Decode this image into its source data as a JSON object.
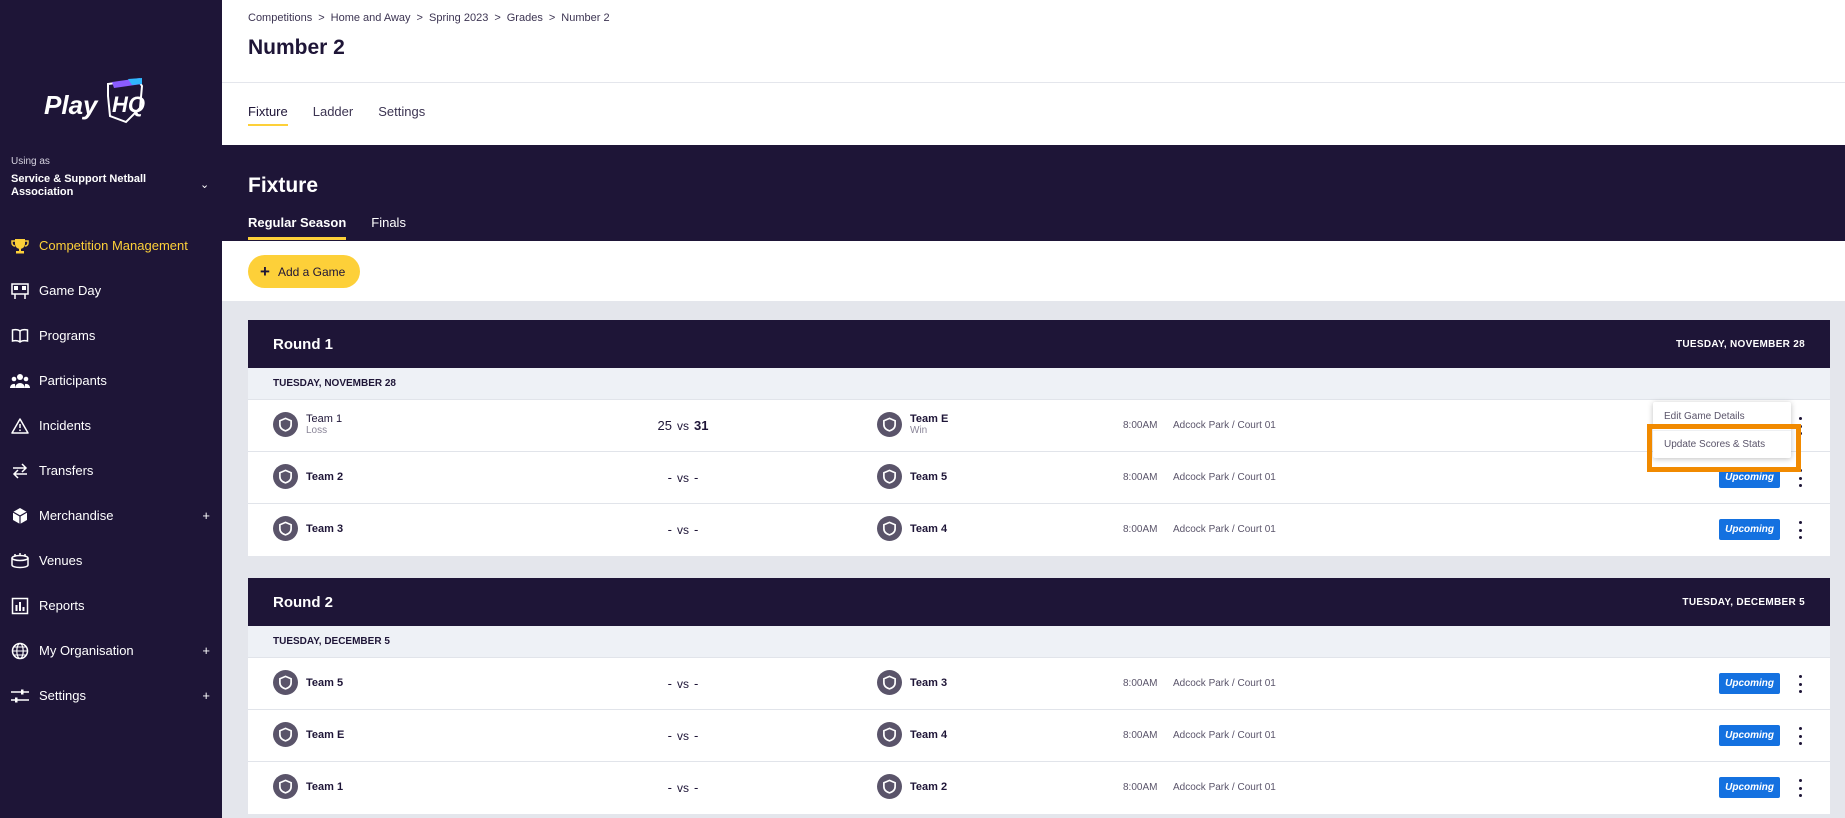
{
  "sidebar": {
    "logo_text": "PlayHQ",
    "using_as_label": "Using as",
    "org_name": "Service & Support Netball Association",
    "org_chevron": "⌄",
    "items": [
      {
        "label": "Competition Management",
        "icon": "trophy-icon",
        "active": true,
        "expandable": false
      },
      {
        "label": "Game Day",
        "icon": "scoreboard-icon",
        "active": false,
        "expandable": false
      },
      {
        "label": "Programs",
        "icon": "book-icon",
        "active": false,
        "expandable": false
      },
      {
        "label": "Participants",
        "icon": "people-icon",
        "active": false,
        "expandable": false
      },
      {
        "label": "Incidents",
        "icon": "warning-icon",
        "active": false,
        "expandable": false
      },
      {
        "label": "Transfers",
        "icon": "transfer-arrows-icon",
        "active": false,
        "expandable": false
      },
      {
        "label": "Merchandise",
        "icon": "box-icon",
        "active": false,
        "expandable": true
      },
      {
        "label": "Venues",
        "icon": "stadium-icon",
        "active": false,
        "expandable": false
      },
      {
        "label": "Reports",
        "icon": "report-icon",
        "active": false,
        "expandable": false
      },
      {
        "label": "My Organisation",
        "icon": "globe-icon",
        "active": false,
        "expandable": true
      },
      {
        "label": "Settings",
        "icon": "sliders-icon",
        "active": false,
        "expandable": true
      }
    ],
    "expand_symbol": "+"
  },
  "header": {
    "breadcrumb": [
      "Competitions",
      "Home and Away",
      "Spring 2023",
      "Grades",
      "Number 2"
    ],
    "breadcrumb_sep": ">",
    "title": "Number 2",
    "tabs": [
      "Fixture",
      "Ladder",
      "Settings"
    ]
  },
  "fixture": {
    "title": "Fixture",
    "subtabs": [
      "Regular Season",
      "Finals"
    ],
    "add_game_label": "Add a Game"
  },
  "rounds": [
    {
      "title": "Round 1",
      "date": "TUESDAY, NOVEMBER 28",
      "day_label": "TUESDAY, NOVEMBER 28",
      "games": [
        {
          "home": "Team 1",
          "home_result": "Loss",
          "home_score": "25",
          "away": "Team E",
          "away_result": "Win",
          "away_score": "31",
          "time": "8:00AM",
          "venue": "Adcock Park / Court 01",
          "status": ""
        },
        {
          "home": "Team 2",
          "home_result": "",
          "home_score": "-",
          "away": "Team 5",
          "away_result": "",
          "away_score": "-",
          "time": "8:00AM",
          "venue": "Adcock Park / Court 01",
          "status": "Upcoming"
        },
        {
          "home": "Team 3",
          "home_result": "",
          "home_score": "-",
          "away": "Team 4",
          "away_result": "",
          "away_score": "-",
          "time": "8:00AM",
          "venue": "Adcock Park / Court 01",
          "status": "Upcoming"
        }
      ]
    },
    {
      "title": "Round 2",
      "date": "TUESDAY, DECEMBER 5",
      "day_label": "TUESDAY, DECEMBER 5",
      "games": [
        {
          "home": "Team 5",
          "home_result": "",
          "home_score": "-",
          "away": "Team 3",
          "away_result": "",
          "away_score": "-",
          "time": "8:00AM",
          "venue": "Adcock Park / Court 01",
          "status": "Upcoming"
        },
        {
          "home": "Team E",
          "home_result": "",
          "home_score": "-",
          "away": "Team 4",
          "away_result": "",
          "away_score": "-",
          "time": "8:00AM",
          "venue": "Adcock Park / Court 01",
          "status": "Upcoming"
        },
        {
          "home": "Team 1",
          "home_result": "",
          "home_score": "-",
          "away": "Team 2",
          "away_result": "",
          "away_score": "-",
          "time": "8:00AM",
          "venue": "Adcock Park / Court 01",
          "status": "Upcoming"
        }
      ]
    }
  ],
  "vs_label": "vs",
  "game_menu": {
    "items": [
      "Edit Game Details",
      "Update Scores & Stats"
    ],
    "highlighted_item": "Update Scores & Stats"
  },
  "colors": {
    "navy": "#1e1537",
    "accent_yellow": "#fdd039",
    "status_blue": "#1471e0",
    "highlight_orange": "#f18a00"
  }
}
